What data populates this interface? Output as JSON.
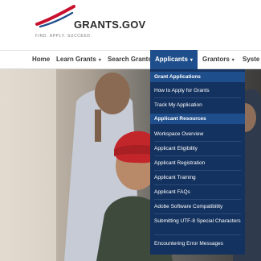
{
  "brand": {
    "name": "GRANTS.GOV",
    "tagline": "FIND. APPLY. SUCCEED.",
    "colors": {
      "primary": "#1f4e8c",
      "dropdown": "#14325f",
      "logo_red": "#c8102e"
    }
  },
  "nav": {
    "items": [
      {
        "label": "Home",
        "caret": ""
      },
      {
        "label": "Learn Grants",
        "caret": "▾"
      },
      {
        "label": "Search Grants",
        "caret": ""
      },
      {
        "label": "Applicants",
        "caret": "▾"
      },
      {
        "label": "Grantors",
        "caret": "▾"
      },
      {
        "label": "Syste",
        "caret": ""
      }
    ]
  },
  "dropdown": {
    "items": [
      {
        "label": "Grant Applications",
        "heading": true
      },
      {
        "label": "How to Apply for Grants",
        "heading": false
      },
      {
        "label": "Track My Application",
        "heading": false
      },
      {
        "label": "Applicant Resources",
        "heading": true
      },
      {
        "label": "Workspace Overview",
        "heading": false
      },
      {
        "label": "Applicant Eligibility",
        "heading": false
      },
      {
        "label": "Applicant Registration",
        "heading": false
      },
      {
        "label": "Applicant Training",
        "heading": false
      },
      {
        "label": "Applicant FAQs",
        "heading": false
      },
      {
        "label": "Adobe Software Compatibility",
        "heading": false
      },
      {
        "label": "Submitting UTF-8 Special Characters",
        "heading": false
      },
      {
        "label": "Encountering Error Messages",
        "heading": false
      }
    ]
  }
}
